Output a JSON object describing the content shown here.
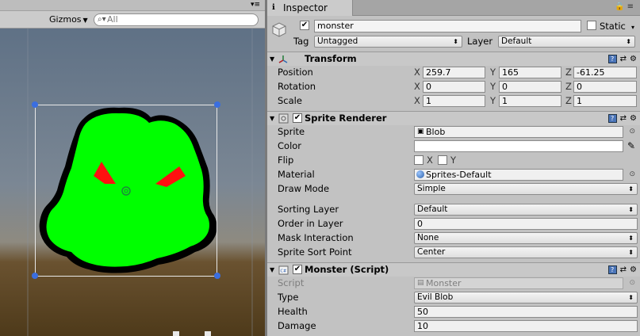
{
  "scene": {
    "gizmos_label": "Gizmos",
    "search_placeholder": "All",
    "colors": {
      "sky": "#586c82",
      "ground": "#5a4420",
      "blob": "#00ff00",
      "eyes": "#ff1010",
      "handles": "#3a6ee0"
    }
  },
  "inspector": {
    "tab_label": "Inspector",
    "object_name": "monster",
    "static_label": "Static",
    "tag_label": "Tag",
    "tag_value": "Untagged",
    "layer_label": "Layer",
    "layer_value": "Default",
    "transform": {
      "title": "Transform",
      "position_label": "Position",
      "rotation_label": "Rotation",
      "scale_label": "Scale",
      "position": {
        "x": "259.7",
        "y": "165",
        "z": "-61.25"
      },
      "rotation": {
        "x": "0",
        "y": "0",
        "z": "0"
      },
      "scale": {
        "x": "1",
        "y": "1",
        "z": "1"
      },
      "x_axis": "X",
      "y_axis": "Y",
      "z_axis": "Z"
    },
    "sprite_renderer": {
      "title": "Sprite Renderer",
      "sprite_label": "Sprite",
      "sprite_value": "Blob",
      "color_label": "Color",
      "flip_label": "Flip",
      "flip_x": "X",
      "flip_y": "Y",
      "material_label": "Material",
      "material_value": "Sprites-Default",
      "draw_mode_label": "Draw Mode",
      "draw_mode_value": "Simple",
      "sorting_layer_label": "Sorting Layer",
      "sorting_layer_value": "Default",
      "order_label": "Order in Layer",
      "order_value": "0",
      "mask_label": "Mask Interaction",
      "mask_value": "None",
      "sort_point_label": "Sprite Sort Point",
      "sort_point_value": "Center"
    },
    "monster_script": {
      "title": "Monster (Script)",
      "script_label": "Script",
      "script_value": "Monster",
      "type_label": "Type",
      "type_value": "Evil Blob",
      "health_label": "Health",
      "health_value": "50",
      "damage_label": "Damage",
      "damage_value": "10"
    }
  }
}
